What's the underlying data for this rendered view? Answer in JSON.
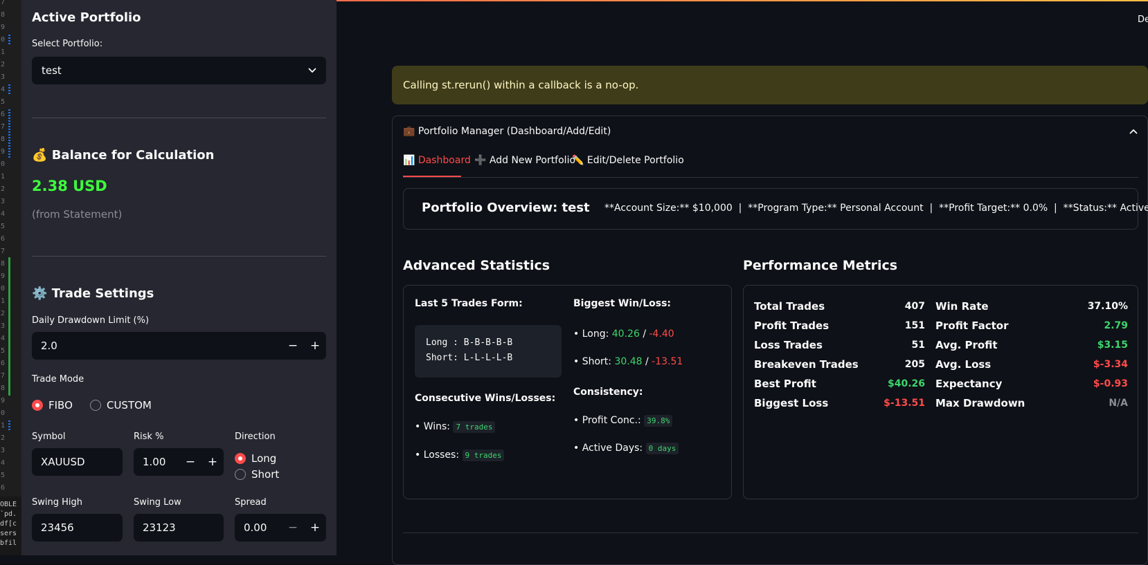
{
  "gutter": {
    "line_numbers": [
      "7",
      "8",
      "9",
      "0",
      "1",
      "2",
      "3",
      "4",
      "5",
      "6",
      "7",
      "8",
      "9",
      "0",
      "1",
      "2",
      "3",
      "4",
      "5",
      "6",
      "7",
      "8",
      "9",
      "0",
      "1",
      "2",
      "3",
      "4",
      "5",
      "6",
      "7",
      "8",
      "9",
      "0",
      "1",
      "2",
      "3",
      "4",
      "5",
      "6"
    ],
    "panel_lines": [
      "OBLE",
      "`pd.",
      "df[c",
      "sers",
      "bfil"
    ]
  },
  "sidebar": {
    "active_portfolio_title": "Active Portfolio",
    "select_portfolio_label": "Select Portfolio:",
    "selected_portfolio": "test",
    "balance_icon": "💰",
    "balance_title": "Balance for Calculation",
    "balance_value": "2.38 USD",
    "balance_source": "(from Statement)",
    "trade_settings_icon": "⚙️",
    "trade_settings_title": "Trade Settings",
    "daily_drawdown_label": "Daily Drawdown Limit (%)",
    "daily_drawdown_value": "2.0",
    "trade_mode_label": "Trade Mode",
    "trade_mode_options": [
      "FIBO",
      "CUSTOM"
    ],
    "trade_mode_selected": "FIBO",
    "symbol_label": "Symbol",
    "symbol_value": "XAUUSD",
    "risk_label": "Risk %",
    "risk_value": "1.00",
    "direction_label": "Direction",
    "direction_options": [
      "Long",
      "Short"
    ],
    "direction_selected": "Long",
    "swing_high_label": "Swing High",
    "swing_high_value": "23456",
    "swing_low_label": "Swing Low",
    "swing_low_value": "23123",
    "spread_label": "Spread",
    "spread_value": "0.00",
    "minus": "−",
    "plus": "+"
  },
  "header": {
    "deploy_text": "De"
  },
  "alert": {
    "text": "Calling st.rerun() within a callback is a no-op."
  },
  "expander": {
    "icon": "💼",
    "title": "Portfolio Manager (Dashboard/Add/Edit)",
    "tabs": [
      {
        "icon": "📊",
        "label": "Dashboard"
      },
      {
        "icon": "➕",
        "label": "Add New Portfolio"
      },
      {
        "icon": "✏️",
        "label": "Edit/Delete Portfolio"
      }
    ]
  },
  "overview": {
    "title": "Portfolio Overview: test",
    "details": "**Account Size:** $10,000  |  **Program Type:** Personal Account  |  **Profit Target:** 0.0%  |  **Status:** Active"
  },
  "advanced": {
    "title": "Advanced Statistics",
    "last5_title": "Last 5 Trades Form:",
    "last5_long": "Long : B-B-B-B-B",
    "last5_short": "Short: L-L-L-L-B",
    "consec_title": "Consecutive Wins/Losses:",
    "wins_label": "• Wins:",
    "wins_value": "7 trades",
    "losses_label": "• Losses:",
    "losses_value": "9 trades",
    "biggest_title": "Biggest Win/Loss:",
    "long_label": "• Long:",
    "long_win": "40.26",
    "long_loss": "-4.40",
    "short_label": "• Short:",
    "short_win": "30.48",
    "short_loss": "-13.51",
    "slash": "/",
    "consistency_title": "Consistency:",
    "profit_conc_label": "• Profit Conc.:",
    "profit_conc_value": "39.8%",
    "active_days_label": "• Active Days:",
    "active_days_value": "0 days"
  },
  "performance": {
    "title": "Performance Metrics",
    "left": [
      {
        "label": "Total Trades",
        "value": "407",
        "color": "#fafafa"
      },
      {
        "label": "Profit Trades",
        "value": "151",
        "color": "#fafafa"
      },
      {
        "label": "Loss Trades",
        "value": "51",
        "color": "#fafafa"
      },
      {
        "label": "Breakeven Trades",
        "value": "205",
        "color": "#fafafa"
      },
      {
        "label": "Best Profit",
        "value": "$40.26",
        "color": "#3dd56d"
      },
      {
        "label": "Biggest Loss",
        "value": "$-13.51",
        "color": "#ff4b4b"
      }
    ],
    "right": [
      {
        "label": "Win Rate",
        "value": "37.10%",
        "color": "#fafafa"
      },
      {
        "label": "Profit Factor",
        "value": "2.79",
        "color": "#3dd56d"
      },
      {
        "label": "Avg. Profit",
        "value": "$3.15",
        "color": "#3dd56d"
      },
      {
        "label": "Avg. Loss",
        "value": "$-3.34",
        "color": "#ff4b4b"
      },
      {
        "label": "Expectancy",
        "value": "$-0.93",
        "color": "#ff4b4b"
      },
      {
        "label": "Max Drawdown",
        "value": "N/A",
        "color": "#8b8d97"
      }
    ]
  }
}
